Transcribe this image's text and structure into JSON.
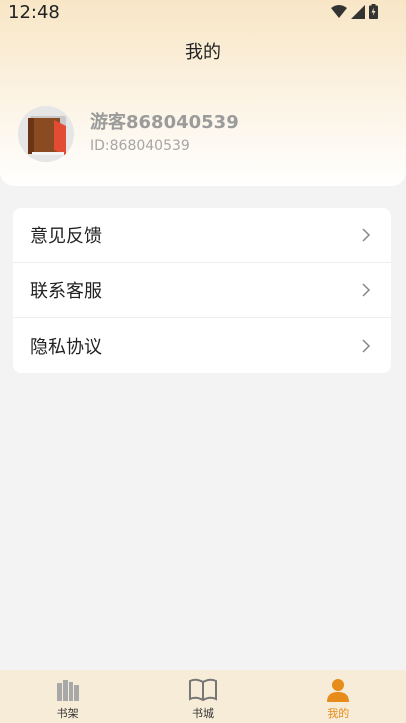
{
  "status_bar": {
    "time": "12:48"
  },
  "header": {
    "title": "我的"
  },
  "profile": {
    "username": "游客868040539",
    "user_id": "ID:868040539"
  },
  "menu": {
    "items": [
      {
        "label": "意见反馈"
      },
      {
        "label": "联系客服"
      },
      {
        "label": "隐私协议"
      }
    ]
  },
  "tabbar": {
    "items": [
      {
        "label": "书架",
        "icon": "bookshelf-icon"
      },
      {
        "label": "书城",
        "icon": "book-open-icon"
      },
      {
        "label": "我的",
        "icon": "person-icon"
      }
    ],
    "active_index": 2
  },
  "colors": {
    "accent": "#e78b1a",
    "header_top": "#f8e6c6",
    "tabbar_bg": "#f7ecd7"
  }
}
